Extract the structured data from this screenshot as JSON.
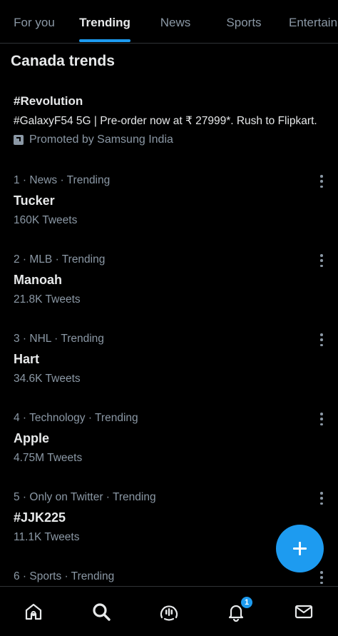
{
  "tabs": [
    {
      "label": "For you"
    },
    {
      "label": "Trending"
    },
    {
      "label": "News"
    },
    {
      "label": "Sports"
    },
    {
      "label": "Entertainment"
    }
  ],
  "active_tab": "Trending",
  "section_title": "Canada trends",
  "promoted": {
    "hashtag": "#Revolution",
    "text": "#GalaxyF54 5G | Pre-order now at ₹ 27999*. Rush to Flipkart.",
    "by": "Promoted by Samsung India"
  },
  "trends": [
    {
      "meta": "1 · News · Trending",
      "name": "Tucker",
      "count": "160K Tweets"
    },
    {
      "meta": "2 · MLB · Trending",
      "name": "Manoah",
      "count": "21.8K Tweets"
    },
    {
      "meta": "3 · NHL · Trending",
      "name": "Hart",
      "count": "34.6K Tweets"
    },
    {
      "meta": "4 · Technology · Trending",
      "name": "Apple",
      "count": "4.75M Tweets"
    },
    {
      "meta": "5 · Only on Twitter · Trending",
      "name": "#JJK225",
      "count": "11.1K Tweets"
    },
    {
      "meta": "6 · Sports · Trending",
      "name": "",
      "count": ""
    }
  ],
  "bottom_nav": {
    "items": [
      "home-icon",
      "search-icon",
      "spaces-icon",
      "notifications-icon",
      "messages-icon"
    ],
    "notification_badge": "1"
  },
  "colors": {
    "accent": "#1d9bf0",
    "background": "#000000",
    "secondary_text": "#8b98a5"
  }
}
